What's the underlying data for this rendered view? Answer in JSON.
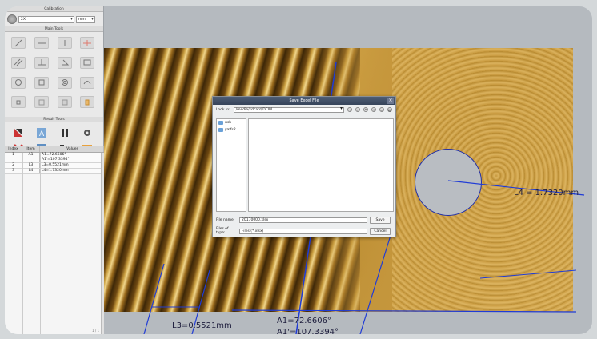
{
  "calibration": {
    "title": "Calibration",
    "zoom_value": "2X",
    "unit_value": "mm"
  },
  "main_tools": {
    "title": "Main Tools"
  },
  "result_tools": {
    "title": "Result Tools"
  },
  "table": {
    "headers": [
      "Index",
      "Item",
      "Values"
    ],
    "rows": [
      {
        "index": "1",
        "item": "A1",
        "values": "A1=72.6606°\nA1'=107.3394°"
      },
      {
        "index": "2",
        "item": "L3",
        "values": "L3=0.5521mm"
      },
      {
        "index": "3",
        "item": "L4",
        "values": "L4=1.7320mm"
      }
    ],
    "page_indicator": "1 / 1"
  },
  "measurements": {
    "l4": "L4 = 1.7320mm",
    "l3": "L3=0.5521mm",
    "a1": "A1=72.6606°",
    "a1p": "A1'=107.3394°"
  },
  "dialog": {
    "title": "Save Excel File",
    "look_in_label": "Look in:",
    "look_in_value": "/media/sdcard/DCIM",
    "sidebar": [
      "usb",
      "yaffs2"
    ],
    "file_name_label": "File name:",
    "file_name_value": "20170000.xlsx",
    "file_type_label": "Files of type:",
    "file_type_value": "Files (*.xlsx)",
    "save_label": "Save",
    "cancel_label": "Cancel",
    "close_glyph": "×"
  },
  "colors": {
    "measurement_line": "#1f3bd6",
    "dialog_title_bg": "#3f4d64",
    "brass": "#c79b3d"
  }
}
